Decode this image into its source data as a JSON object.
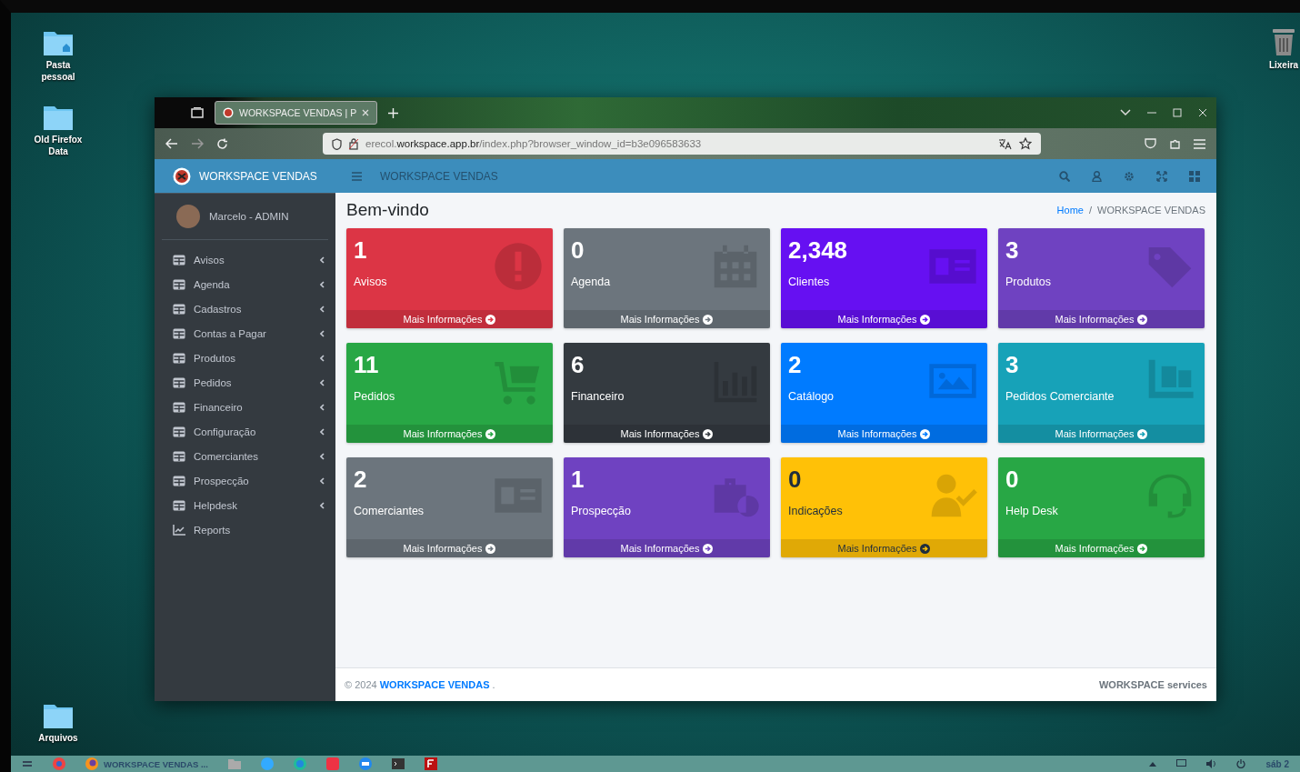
{
  "desktop": {
    "icons": [
      {
        "label": "Pasta pessoal",
        "kind": "home"
      },
      {
        "label": "Old Firefox Data",
        "kind": "folder"
      },
      {
        "label": "Arquivos",
        "kind": "folder"
      },
      {
        "label": "Lixeira",
        "kind": "trash"
      }
    ]
  },
  "browser": {
    "tab": {
      "title": "WORKSPACE VENDAS | P"
    },
    "url": "erecol.**workspace.app.br**/index.php?browser_window_id=b3e096583633"
  },
  "app": {
    "brand": "WORKSPACE VENDAS",
    "header_title": "WORKSPACE VENDAS",
    "user": "Marcelo - ADMIN",
    "menu": [
      {
        "label": "Avisos",
        "kind": "group"
      },
      {
        "label": "Agenda",
        "kind": "group"
      },
      {
        "label": "Cadastros",
        "kind": "group"
      },
      {
        "label": "Contas a Pagar",
        "kind": "group"
      },
      {
        "label": "Produtos",
        "kind": "group"
      },
      {
        "label": "Pedidos",
        "kind": "group"
      },
      {
        "label": "Financeiro",
        "kind": "group"
      },
      {
        "label": "Configuração",
        "kind": "group"
      },
      {
        "label": "Comerciantes",
        "kind": "group"
      },
      {
        "label": "Prospecção",
        "kind": "group"
      },
      {
        "label": "Helpdesk",
        "kind": "group"
      },
      {
        "label": "Reports",
        "kind": "link"
      }
    ],
    "page_title": "Bem-vindo",
    "breadcrumb": [
      "Home",
      "WORKSPACE VENDAS"
    ],
    "breadcrumb_separator": "/",
    "cards": [
      {
        "count": "1",
        "label": "Avisos",
        "link": "Mais Informações",
        "color": "#dc3545"
      },
      {
        "count": "0",
        "label": "Agenda",
        "link": "Mais Informações",
        "color": "#6c757d"
      },
      {
        "count": "2,348",
        "label": "Clientes",
        "link": "Mais Informações",
        "color": "#6610f2"
      },
      {
        "count": "3",
        "label": "Produtos",
        "link": "Mais Informações",
        "color": "#6f42c1"
      },
      {
        "count": "11",
        "label": "Pedidos",
        "link": "Mais Informações",
        "color": "#28a745"
      },
      {
        "count": "6",
        "label": "Financeiro",
        "link": "Mais Informações",
        "color": "#343a40"
      },
      {
        "count": "2",
        "label": "Catálogo",
        "link": "Mais Informações",
        "color": "#007bff"
      },
      {
        "count": "3",
        "label": "Pedidos Comerciante",
        "link": "Mais Informações",
        "color": "#17a2b8"
      },
      {
        "count": "2",
        "label": "Comerciantes",
        "link": "Mais Informações",
        "color": "#6c757d"
      },
      {
        "count": "1",
        "label": "Prospecção",
        "link": "Mais Informações",
        "color": "#6f42c1"
      },
      {
        "count": "0",
        "label": "Indicações",
        "link": "Mais Informações",
        "color": "#ffc107"
      },
      {
        "count": "0",
        "label": "Help Desk",
        "link": "Mais Informações",
        "color": "#28a745"
      }
    ],
    "footer": {
      "prefix": "© 2024",
      "link": "WORKSPACE VENDAS",
      "suffix": ".",
      "right": "WORKSPACE services"
    }
  },
  "taskbar": {
    "window": "WORKSPACE VENDAS ...",
    "clock": "sáb 2"
  }
}
